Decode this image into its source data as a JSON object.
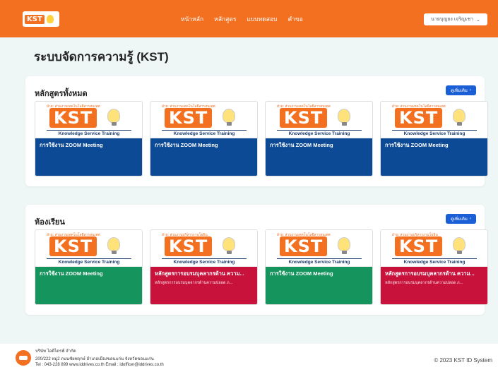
{
  "nav": {
    "logo_text": "KST",
    "links": [
      "หน้าหลัก",
      "หลักสูตร",
      "แบบทดสอบ",
      "คำขอ"
    ],
    "user_label": "นายบุญยง เจริญเชา"
  },
  "page_title": "ระบบจัดการความรู้ (KST)",
  "sections": [
    {
      "title": "หลักสูตรทั้งหมด",
      "more_label": "ดูเพิ่มเติม",
      "cards": [
        {
          "dept": "ฝ่าย: ส่วนงานเทคโนโลยีสารสนเทศ",
          "logo": "KST",
          "tagline": "Knowledge Service Training",
          "title": "การใช้งาน ZOOM Meeting",
          "sub": "",
          "color": "blue"
        },
        {
          "dept": "ฝ่าย: ส่วนงานเทคโนโลยีสารสนเทศ",
          "logo": "KST",
          "tagline": "Knowledge Service Training",
          "title": "การใช้งาน ZOOM Meeting",
          "sub": "",
          "color": "blue"
        },
        {
          "dept": "ฝ่าย: ส่วนงานเทคโนโลยีสารสนเทศ",
          "logo": "KST",
          "tagline": "Knowledge Service Training",
          "title": "การใช้งาน ZOOM Meeting",
          "sub": "",
          "color": "blue"
        },
        {
          "dept": "ฝ่าย: ส่วนงานเทคโนโลยีสารสนเทศ",
          "logo": "KST",
          "tagline": "Knowledge Service Training",
          "title": "การใช้งาน ZOOM Meeting",
          "sub": "",
          "color": "blue"
        }
      ]
    },
    {
      "title": "ห้องเรียน",
      "more_label": "ดูเพิ่มเติม",
      "cards": [
        {
          "dept": "ฝ่าย: ส่วนงานเทคโนโลยีสารสนเทศ",
          "logo": "KST",
          "tagline": "Knowledge Service Training",
          "title": "การใช้งาน ZOOM Meeting",
          "sub": "",
          "color": "green"
        },
        {
          "dept": "ฝ่าย: ส่วนงานบริหารงานโยธิน",
          "logo": "KST",
          "tagline": "Knowledge Service Training",
          "title": "หลักสูตรการอบรมบุคลากรด้าน ความ...",
          "sub": "หลักสูตรการอบรมบุคลากรด้านความปลอด ภ...",
          "color": "red"
        },
        {
          "dept": "ฝ่าย: ส่วนงานเทคโนโลยีสารสนเทศ",
          "logo": "KST",
          "tagline": "Knowledge Service Training",
          "title": "การใช้งาน ZOOM Meeting",
          "sub": "",
          "color": "green"
        },
        {
          "dept": "ฝ่าย: ส่วนงานบริหารงานโยธิน",
          "logo": "KST",
          "tagline": "Knowledge Service Training",
          "title": "หลักสูตรการอบรมบุคลากรด้าน ความ...",
          "sub": "หลักสูตรการอบรมบุคลากรด้านความปลอด ภ...",
          "color": "red"
        }
      ]
    }
  ],
  "footer": {
    "company": "บริษัท ไอดีไดรฟ์ จำกัด",
    "address": "200/222 หมู่2 ถนนชัยพฤกษ์ อำเภอเมืองขอนแก่น จังหวัดขอนแก่น",
    "contact": "Tel : 043-228 899 www.iddrives.co.th Email : idofficer@iddrives.co.th",
    "copyright": "© 2023 KST ID System"
  },
  "colors": {
    "brand": "#f37021",
    "blue": "#0d4a95",
    "green": "#16945e",
    "red": "#c8113b",
    "button": "#1a5fd6"
  }
}
